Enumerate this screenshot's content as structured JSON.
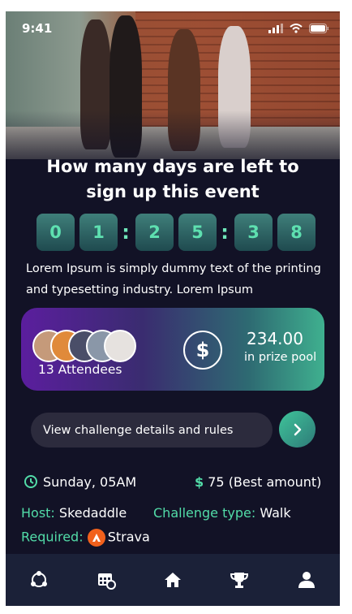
{
  "status_bar": {
    "time": "9:41"
  },
  "event": {
    "title_line1": "How many days are left to",
    "title_line2": "sign up this event",
    "countdown": [
      "0",
      "1",
      "2",
      "5",
      "3",
      "8"
    ],
    "description": "Lorem Ipsum is simply dummy text of the printing and typesetting industry. Lorem Ipsum"
  },
  "prize": {
    "attendees_label": "13 Attendees",
    "currency_symbol": "$",
    "amount": "234.00",
    "pool_label": "in prize pool"
  },
  "details_button": {
    "label": "View challenge details and rules"
  },
  "info": {
    "date": "Sunday, 05AM",
    "price_symbol": "$",
    "price_amount": "75",
    "price_note": "(Best amount)",
    "host_label": "Host:",
    "host_value": "Skedaddle",
    "type_label": "Challenge type:",
    "type_value": "Walk",
    "required_label": "Required:",
    "required_value": "Strava"
  },
  "nav_icons": [
    "community-icon",
    "calendar-icon",
    "home-icon",
    "trophy-icon",
    "profile-icon"
  ],
  "colors": {
    "accent": "#52dca8",
    "background": "#121226",
    "nav": "#1b2138",
    "strava": "#f2611c"
  }
}
